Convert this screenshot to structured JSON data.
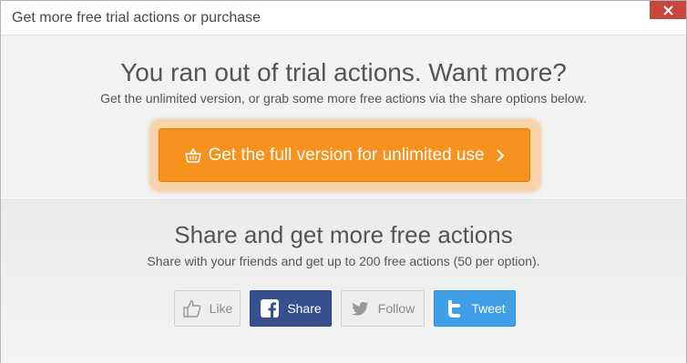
{
  "window": {
    "title": "Get more free trial actions or purchase"
  },
  "top": {
    "headline": "You ran out of trial actions. Want more?",
    "subline": "Get the unlimited version, or grab some more free actions via the share options below.",
    "cta_label": "Get the full version for unlimited use"
  },
  "share": {
    "title": "Share and get more free actions",
    "subtitle": "Share with your friends and get up to 200 free actions (50 per option).",
    "buttons": [
      {
        "label": "Like",
        "icon": "thumbs-up-icon"
      },
      {
        "label": "Share",
        "icon": "facebook-icon"
      },
      {
        "label": "Follow",
        "icon": "twitter-bird-icon"
      },
      {
        "label": "Tweet",
        "icon": "twitter-t-icon"
      }
    ]
  },
  "colors": {
    "accent": "#f7921e",
    "facebook": "#35508c",
    "twitter": "#3f9fe8",
    "close": "#c9463d"
  }
}
